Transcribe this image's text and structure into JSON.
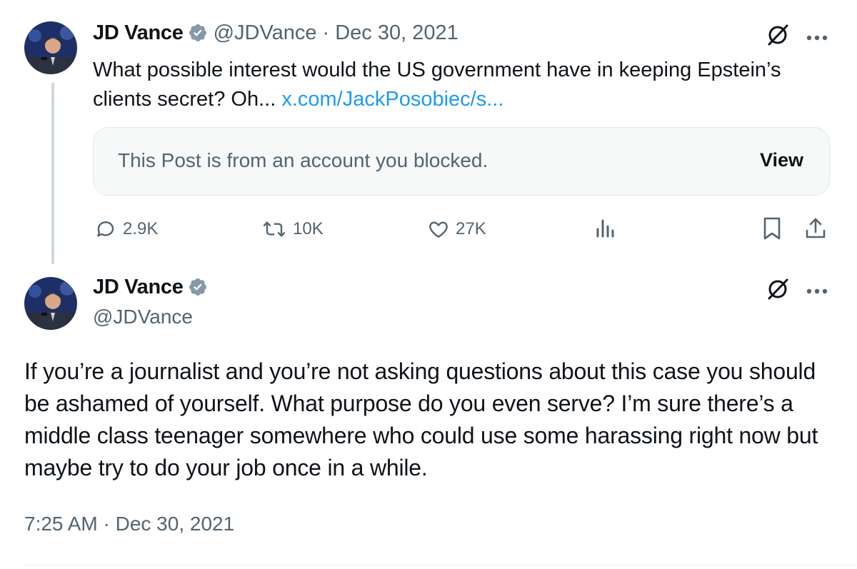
{
  "colors": {
    "text_primary": "#0f1419",
    "text_secondary": "#536471",
    "link": "#1d9bf0",
    "verified_badge": "#829aab",
    "card_background": "#f7f9f9",
    "thread_line": "#cfd9de"
  },
  "quoted_post": {
    "author_name": "JD Vance",
    "verified_icon": "verified-badge-icon",
    "handle": "@JDVance",
    "separator": "·",
    "date": "Dec 30, 2021",
    "text": "What possible interest would the US government have in keeping Epstein’s clients secret? Oh...",
    "link_text": "x.com/JackPosobiec/s...",
    "blocked_notice": "This Post is from an account you blocked.",
    "view_label": "View",
    "actions": {
      "replies": "2.9K",
      "reposts": "10K",
      "likes": "27K"
    }
  },
  "main_post": {
    "author_name": "JD Vance",
    "handle": "@JDVance",
    "text": "If you’re a journalist and you’re not asking questions about this case you should be ashamed of yourself. What purpose do you even serve? I’m sure there’s a middle class teenager somewhere who could use some harassing right now but maybe try to do your job once in a while.",
    "timestamp": "7:25 AM · Dec 30, 2021"
  }
}
